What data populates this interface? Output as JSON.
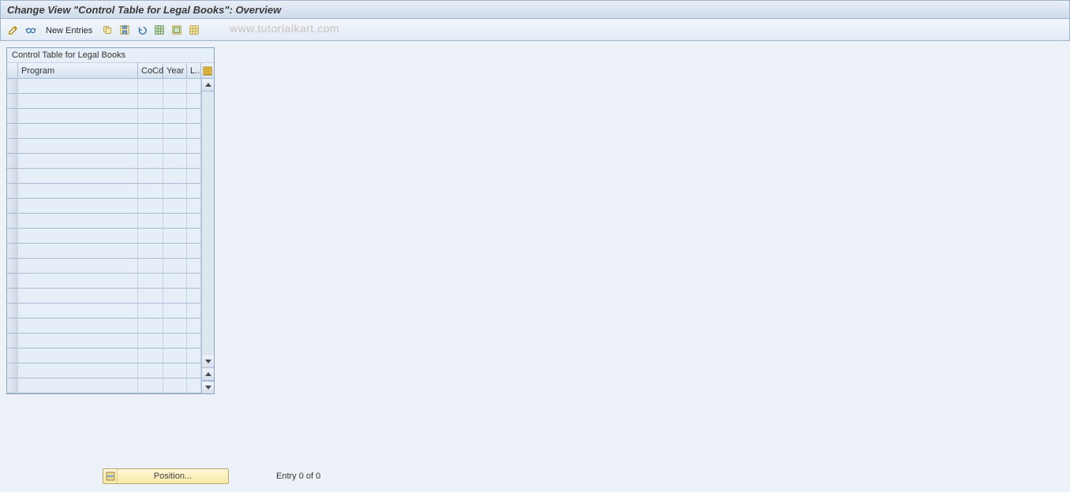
{
  "header": {
    "title": "Change View \"Control Table for Legal Books\": Overview"
  },
  "toolbar": {
    "new_entries_label": "New Entries",
    "icons": {
      "edit": "edit-pencil-icon",
      "glasses": "display-glasses-icon",
      "copy": "copy-icon",
      "save": "save-variant-icon",
      "undo": "undo-icon",
      "select_all": "select-all-icon",
      "select_block": "select-block-icon",
      "deselect": "deselect-all-icon"
    }
  },
  "panel": {
    "title": "Control Table for Legal Books"
  },
  "table": {
    "columns": {
      "program": "Program",
      "cocd": "CoCd",
      "year": "Year",
      "ll": "L.."
    },
    "row_count": 21
  },
  "footer": {
    "position_label": "Position...",
    "entry_status": "Entry 0 of 0"
  },
  "watermark": "www.tutorialkart.com"
}
